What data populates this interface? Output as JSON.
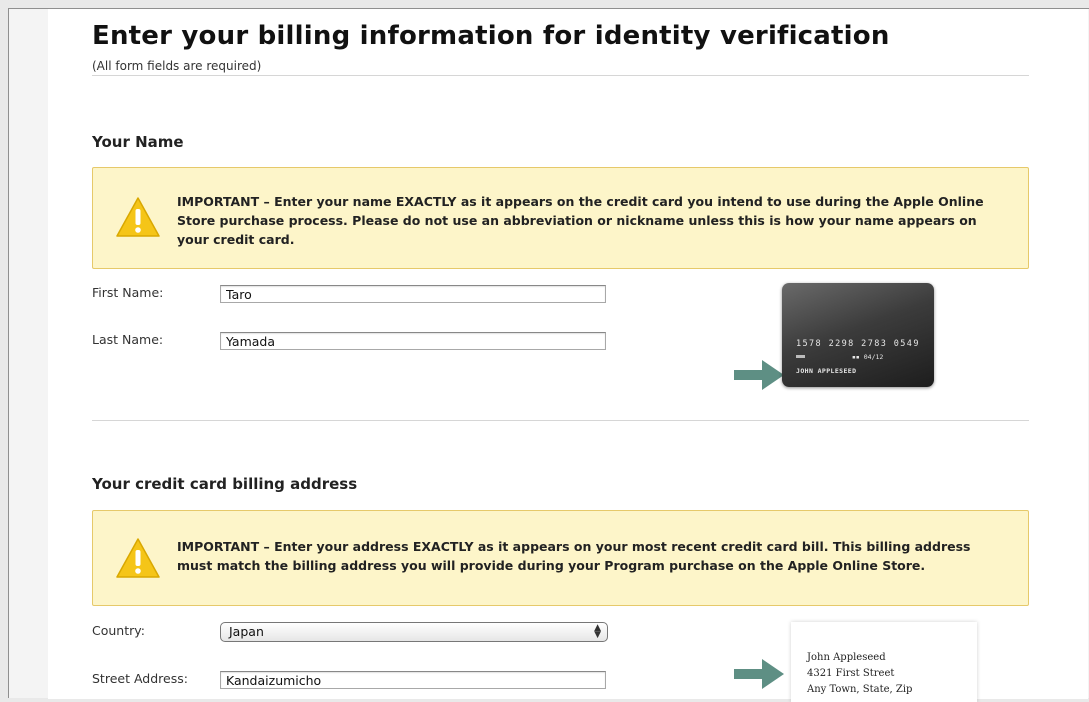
{
  "page": {
    "title": "Enter your billing information for identity verification",
    "subtitle": "(All form fields are required)"
  },
  "name_section": {
    "title": "Your Name",
    "notice": "IMPORTANT – Enter your name EXACTLY as it appears on the credit card you intend to use during the Apple Online Store purchase process. Please do not use an abbreviation or nickname unless this is how your name appears on your credit card.",
    "first_name_label": "First Name:",
    "first_name_value": "Taro",
    "last_name_label": "Last Name:",
    "last_name_value": "Yamada",
    "card_image": {
      "number": "1578 2298 2783 0549",
      "expiry": "04/12",
      "holder": "JOHN APPLESEED"
    }
  },
  "address_section": {
    "title": "Your credit card billing address",
    "notice": "IMPORTANT – Enter your address EXACTLY as it appears on your most recent credit card bill. This billing address must match the billing address you will provide during your Program purchase on the Apple Online Store.",
    "country_label": "Country:",
    "country_value": "Japan",
    "street_label": "Street Address:",
    "street_value": "Kandaizumicho",
    "address_image": {
      "line1": "John Appleseed",
      "line2": "4321 First Street",
      "line3": "Any Town, State, Zip"
    }
  },
  "colors": {
    "notice_bg": "#fdf5c9",
    "notice_border": "#e6c96a",
    "warning_icon": "#f5c518",
    "arrow": "#5e8f84"
  },
  "icons": {
    "warning": "warning-triangle-icon",
    "arrow": "arrow-right-icon"
  }
}
